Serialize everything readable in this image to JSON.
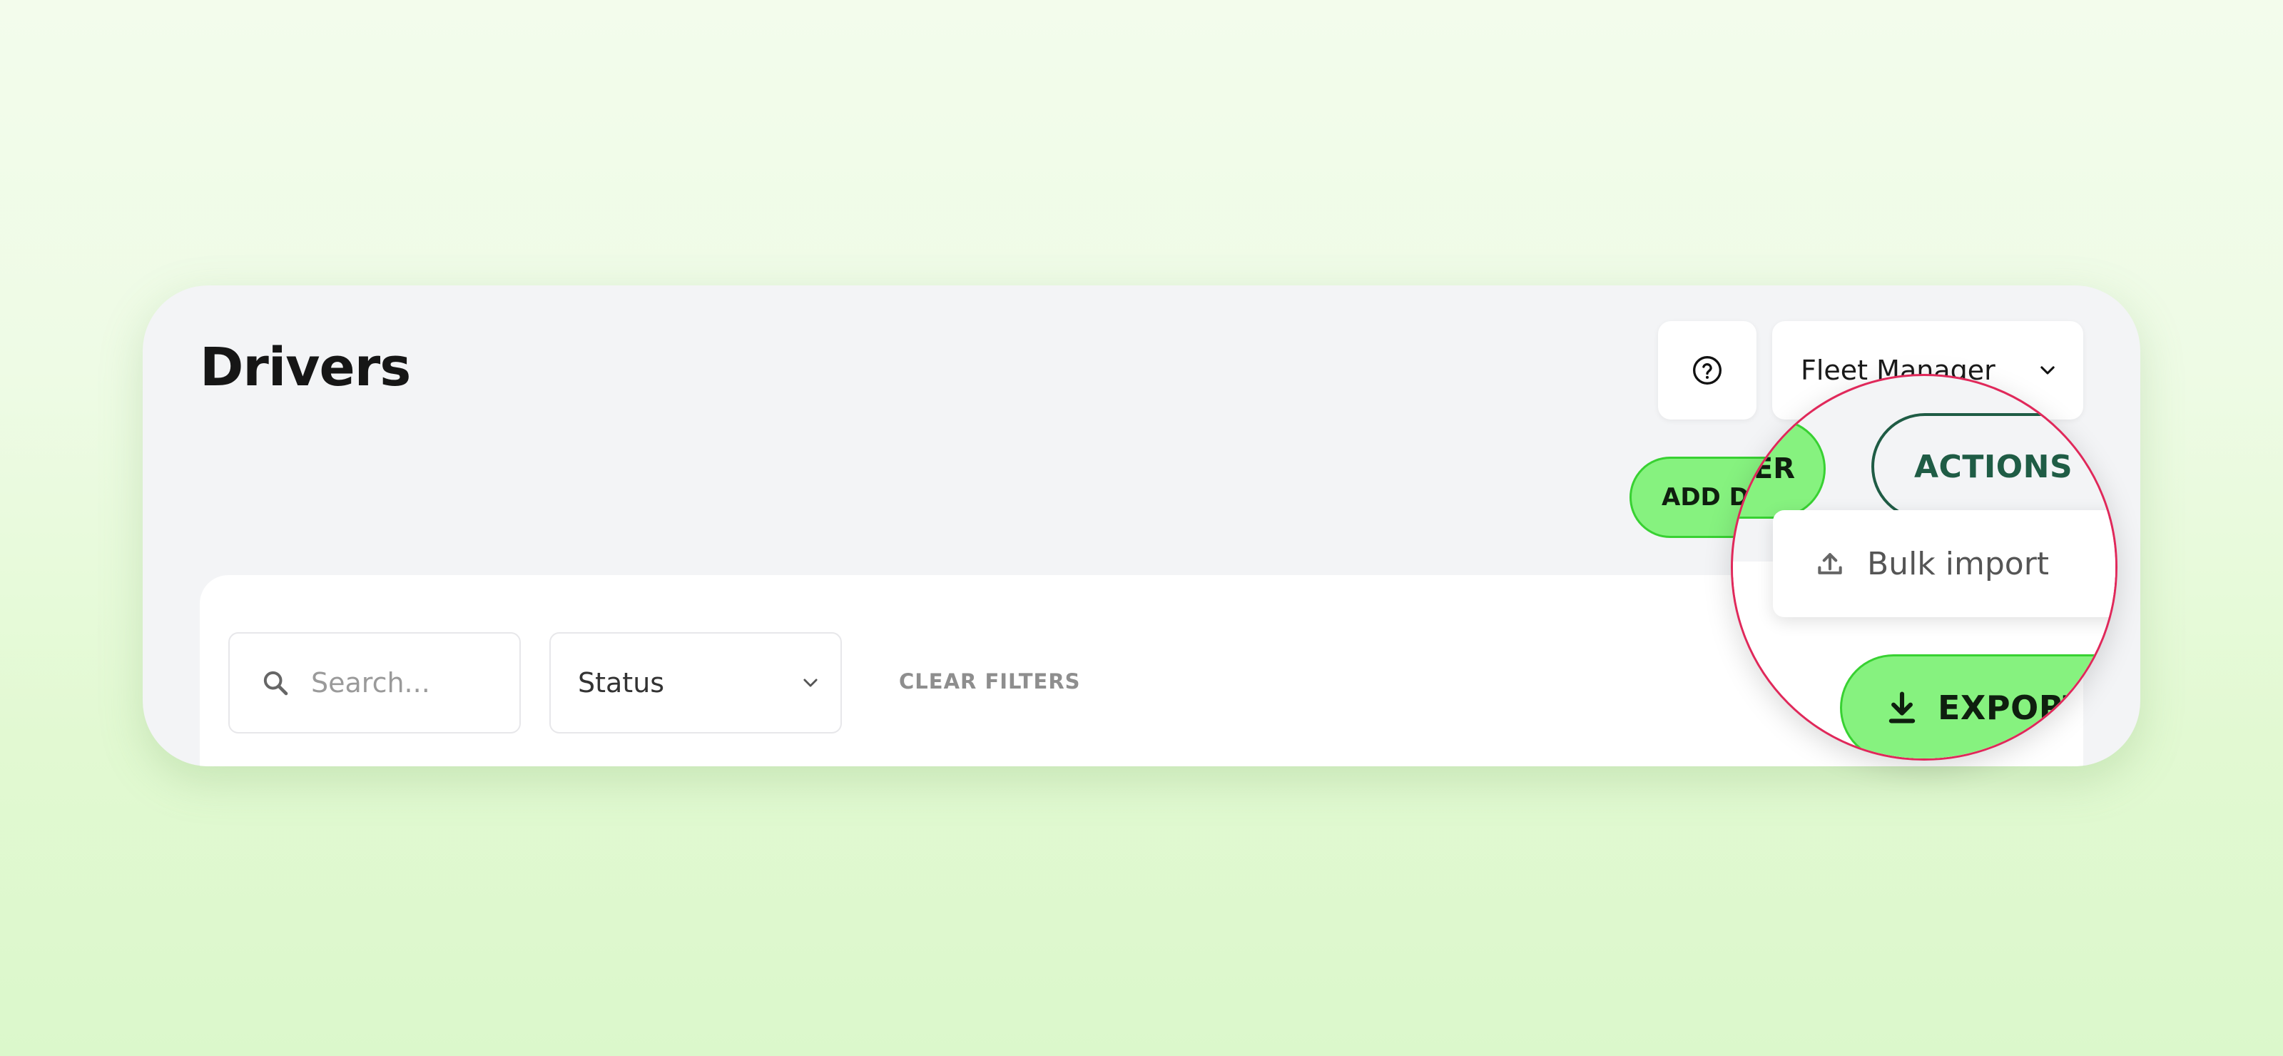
{
  "header": {
    "title": "Drivers",
    "role_select": {
      "value": "Fleet Manager"
    },
    "add_button_label": "ADD DRIVER",
    "actions_button_label": "ACTIONS"
  },
  "actions_menu": {
    "items": [
      {
        "label": "Bulk import",
        "icon": "upload-icon"
      }
    ]
  },
  "filters": {
    "search_placeholder": "Search...",
    "status_select_value": "Status",
    "clear_label": "CLEAR FILTERS"
  },
  "toolbar": {
    "export_label": "EXPORT"
  },
  "colors": {
    "accent_green": "#86f27f",
    "accent_border": "#38d132",
    "actions_outline": "#1f5c45",
    "magnifier_ring": "#e0285a"
  }
}
